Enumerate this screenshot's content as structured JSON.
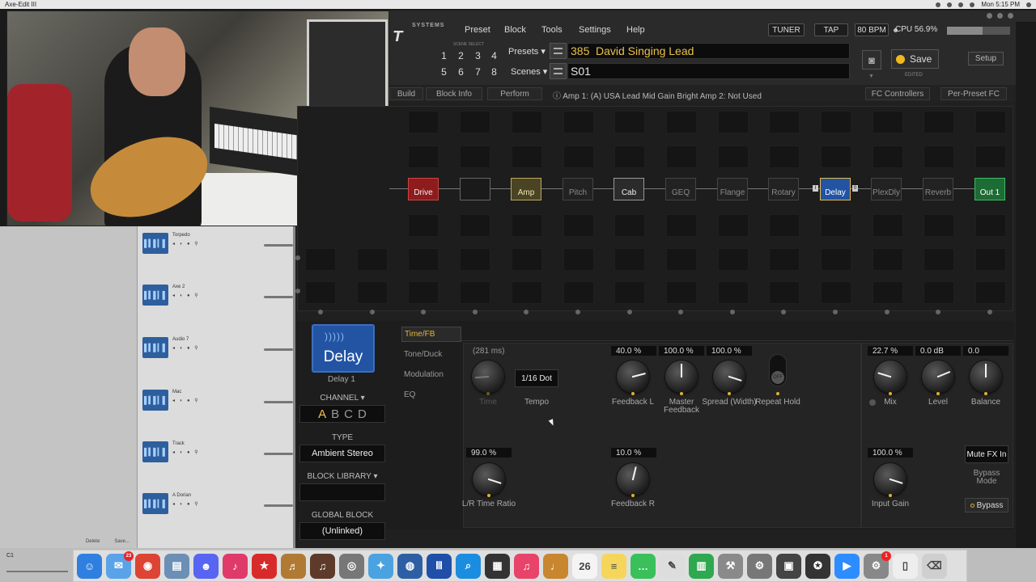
{
  "system_bar": {
    "app_name": "Axe-Edit III",
    "clock": "Mon 5:15 PM"
  },
  "daw": {
    "tracks": [
      {
        "name": "Torpedo"
      },
      {
        "name": "Axe 2"
      },
      {
        "name": "Audio 7"
      },
      {
        "name": "Mac"
      },
      {
        "name": "Track"
      },
      {
        "name": "A Dorian"
      }
    ],
    "footer": {
      "delete": "Delete",
      "save": "Save..."
    },
    "bottom_label": "C1"
  },
  "app": {
    "logo_small": "SYSTEMS",
    "logo_large": "T III",
    "menu": [
      "Preset",
      "Block",
      "Tools",
      "Settings",
      "Help"
    ],
    "tuner": "TUNER",
    "tap": "TAP",
    "bpm": "80 BPM",
    "cpu_label": "CPU 56.9%",
    "cpu_fraction": 0.569,
    "scene_select_label": "SCENE SELECT",
    "scene_numbers": [
      "1",
      "2",
      "3",
      "4",
      "5",
      "6",
      "7",
      "8"
    ],
    "active_scene": "1",
    "presets_label": "Presets",
    "scenes_label": "Scenes",
    "preset_number": "385",
    "preset_name": "David Singing Lead",
    "scene_name": "S01",
    "save_label": "Save",
    "edited_label": "EDITED",
    "setup_label": "Setup",
    "tabs": {
      "build": "Build",
      "block_info": "Block Info",
      "perform": "Perform",
      "fc_controllers": "FC Controllers",
      "per_preset_fc": "Per-Preset FC"
    },
    "amp_info": "Amp 1: (A) USA Lead Mid Gain Bright   Amp 2: Not Used",
    "grid_blocks": [
      {
        "label": "Drive",
        "kind": "drive"
      },
      {
        "label": "",
        "kind": "empty"
      },
      {
        "label": "Amp",
        "kind": "amp"
      },
      {
        "label": "Pitch",
        "kind": "dim"
      },
      {
        "label": "Cab",
        "kind": "cab"
      },
      {
        "label": "GEQ",
        "kind": "dim"
      },
      {
        "label": "Flange",
        "kind": "dim"
      },
      {
        "label": "Rotary",
        "kind": "dim"
      },
      {
        "label": "Delay",
        "kind": "delay"
      },
      {
        "label": "PlexDly",
        "kind": "dim"
      },
      {
        "label": "Reverb",
        "kind": "dim"
      },
      {
        "label": "Out 1",
        "kind": "out"
      }
    ],
    "delay_left_marker": "I",
    "delay_right_marker": "0"
  },
  "block_panel": {
    "block_name": "Delay",
    "block_instance": "Delay 1",
    "channel_label": "CHANNEL",
    "channels": [
      "A",
      "B",
      "C",
      "D"
    ],
    "active_channel": "A",
    "type_label": "TYPE",
    "type_value": "Ambient Stereo",
    "library_label": "BLOCK LIBRARY",
    "library_value": "",
    "global_label": "GLOBAL BLOCK",
    "global_value": "(Unlinked)",
    "pages": [
      "Time/FB",
      "Tone/Duck",
      "Modulation",
      "EQ"
    ],
    "active_page": "Time/FB"
  },
  "params": {
    "time": {
      "value": "(281 ms)",
      "label": "Time",
      "dial": 0.15
    },
    "tempo": {
      "value": "1/16 Dot",
      "label": "Tempo"
    },
    "feedback_l": {
      "value": "40.0 %",
      "label": "Feedback  L",
      "dial": 0.78
    },
    "master_feedback": {
      "value": "100.0 %",
      "label": "Master Feedback",
      "dial": 0.5
    },
    "spread": {
      "value": "100.0 %",
      "label": "Spread (Width)",
      "dial": 0.9
    },
    "repeat_hold": {
      "value": "OFF",
      "label": "Repeat Hold"
    },
    "mix": {
      "value": "22.7 %",
      "label": "Mix",
      "dial": 0.23
    },
    "level": {
      "value": "0.0 dB",
      "label": "Level",
      "dial": 0.75
    },
    "balance": {
      "value": "0.0",
      "label": "Balance",
      "dial": 0.5
    },
    "lr_time_ratio": {
      "value": "99.0 %",
      "label": "L/R Time Ratio",
      "dial": 0.9
    },
    "feedback_r": {
      "value": "10.0 %",
      "label": "Feedback R",
      "dial": 0.55
    },
    "input_gain": {
      "value": "100.0 %",
      "label": "Input Gain",
      "dial": 0.9
    },
    "mute_fx_in": "Mute FX In",
    "bypass_mode": "Bypass Mode",
    "bypass": "Bypass"
  },
  "dock": {
    "icons": [
      {
        "name": "finder-icon",
        "color": "#2f7fe0",
        "glyph": "☺"
      },
      {
        "name": "mail-icon",
        "color": "#5aa3e8",
        "glyph": "✉",
        "badge": "23"
      },
      {
        "name": "chrome-icon",
        "color": "#dd4433",
        "glyph": "◉"
      },
      {
        "name": "preview-icon",
        "color": "#6b8fb5",
        "glyph": "▤"
      },
      {
        "name": "discord-icon",
        "color": "#5865f2",
        "glyph": "☻"
      },
      {
        "name": "sing-studio-icon",
        "color": "#e03a6a",
        "glyph": "♪"
      },
      {
        "name": "bookmark-icon",
        "color": "#d92a2a",
        "glyph": "★"
      },
      {
        "name": "guitar-icon",
        "color": "#b07a35",
        "glyph": "♬"
      },
      {
        "name": "amp-app-icon",
        "color": "#5d3a2a",
        "glyph": "♫"
      },
      {
        "name": "utility-icon",
        "color": "#777777",
        "glyph": "◎"
      },
      {
        "name": "vpn-icon",
        "color": "#4aa3e0",
        "glyph": "✦"
      },
      {
        "name": "globe-icon",
        "color": "#2e5fa5",
        "glyph": "◍"
      },
      {
        "name": "axe-edit-icon",
        "color": "#1f4fa8",
        "glyph": "Ⅲ"
      },
      {
        "name": "search-app-icon",
        "color": "#1a8de0",
        "glyph": "⌕"
      },
      {
        "name": "clapper-icon",
        "color": "#333333",
        "glyph": "▦"
      },
      {
        "name": "music-icon",
        "color": "#e8446a",
        "glyph": "♫"
      },
      {
        "name": "instrument-icon",
        "color": "#c8862f",
        "glyph": "♩"
      },
      {
        "name": "calendar-icon",
        "color": "#f4f4f4",
        "glyph": "26"
      },
      {
        "name": "notes-icon",
        "color": "#f5d65a",
        "glyph": "≡"
      },
      {
        "name": "messages-icon",
        "color": "#39c05a",
        "glyph": "…"
      },
      {
        "name": "textedit-icon",
        "color": "#dddddd",
        "glyph": "✎"
      },
      {
        "name": "numbers-icon",
        "color": "#2fa84f",
        "glyph": "▥"
      },
      {
        "name": "tools-icon",
        "color": "#8a8a8a",
        "glyph": "⚒"
      },
      {
        "name": "robot-icon",
        "color": "#777777",
        "glyph": "⚙"
      },
      {
        "name": "logic-icon",
        "color": "#444444",
        "glyph": "▣"
      },
      {
        "name": "compass-icon",
        "color": "#333333",
        "glyph": "✪"
      },
      {
        "name": "zoom-icon",
        "color": "#2d8cff",
        "glyph": "▶"
      },
      {
        "name": "system-prefs-icon",
        "color": "#888888",
        "glyph": "⚙",
        "badge": "1"
      },
      {
        "name": "document-icon",
        "color": "#eeeeee",
        "glyph": "▯"
      },
      {
        "name": "trash-icon",
        "color": "#cfcfcf",
        "glyph": "⌫"
      }
    ]
  }
}
